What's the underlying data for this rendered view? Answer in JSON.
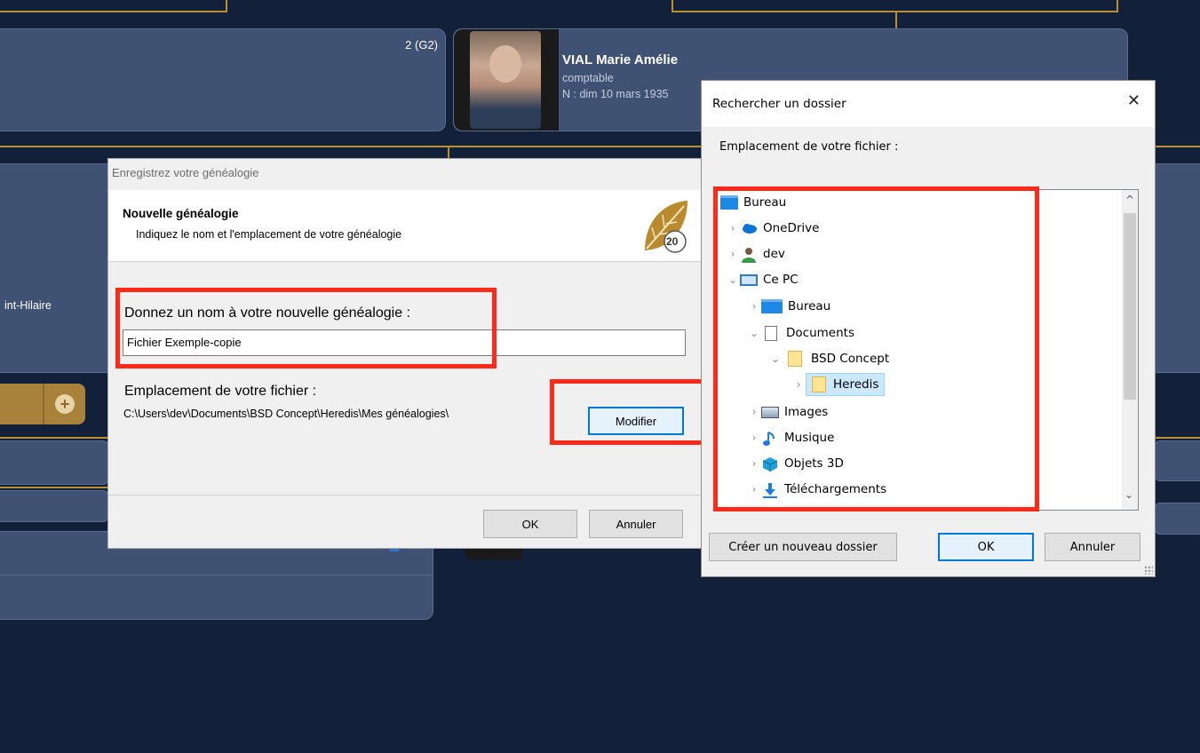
{
  "background": {
    "card_number": "2 (G2)",
    "person_name": "VIAL Marie Amélie",
    "person_job": "comptable",
    "person_birth": "N : dim 10 mars 1935",
    "place_fragment": "int-Hilaire",
    "add_symbol": "+"
  },
  "save_dialog": {
    "title": "Enregistrez votre généalogie",
    "header_title": "Nouvelle généalogie",
    "header_subtitle": "Indiquez le nom et l'emplacement de votre généalogie",
    "logo_badge": "20",
    "name_label": "Donnez un nom à votre nouvelle généalogie :",
    "name_value": "Fichier Exemple-copie",
    "location_label": "Emplacement de votre fichier :",
    "location_path": "C:\\Users\\dev\\Documents\\BSD Concept\\Heredis\\Mes généalogies\\",
    "modify_button": "Modifier",
    "ok_button": "OK",
    "cancel_button": "Annuler"
  },
  "folder_dialog": {
    "title": "Rechercher un dossier",
    "close_symbol": "✕",
    "subtitle": "Emplacement de votre fichier :",
    "tree": [
      {
        "label": "Bureau",
        "icon": "desktop-icon",
        "arrow": ""
      },
      {
        "label": "OneDrive",
        "icon": "cloud-icon",
        "arrow": "›"
      },
      {
        "label": "dev",
        "icon": "user-icon",
        "arrow": "›"
      },
      {
        "label": "Ce PC",
        "icon": "computer-icon",
        "arrow": "⌄"
      },
      {
        "label": "Bureau",
        "icon": "desktop-icon",
        "arrow": "›"
      },
      {
        "label": "Documents",
        "icon": "documents-icon",
        "arrow": "⌄"
      },
      {
        "label": "BSD Concept",
        "icon": "folder-icon",
        "arrow": "⌄"
      },
      {
        "label": "Heredis",
        "icon": "folder-icon",
        "arrow": "›"
      },
      {
        "label": "Images",
        "icon": "images-icon",
        "arrow": "›"
      },
      {
        "label": "Musique",
        "icon": "music-icon",
        "arrow": "›"
      },
      {
        "label": "Objets 3D",
        "icon": "objects3d-icon",
        "arrow": "›"
      },
      {
        "label": "Téléchargements",
        "icon": "download-icon",
        "arrow": "›"
      }
    ],
    "scroll_up": "^",
    "scroll_down": "⌄",
    "new_folder_button": "Créer un nouveau dossier",
    "ok_button": "OK",
    "cancel_button": "Annuler"
  },
  "colors": {
    "highlight_red": "#ff2a1a",
    "bg_navy": "#13203a",
    "card_blue": "#3f5273",
    "gold": "#b98f33",
    "windows_blue": "#0078d7"
  }
}
